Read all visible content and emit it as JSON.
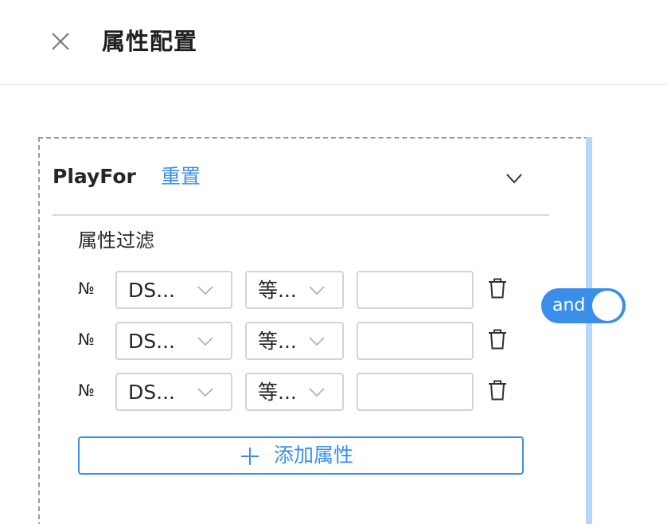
{
  "header": {
    "title": "属性配置",
    "close_icon": "close-icon"
  },
  "group": {
    "name": "PlayFor",
    "reset_label": "重置",
    "collapse_icon": "chevron-down-icon"
  },
  "filter": {
    "section_label": "属性过滤",
    "rows": [
      {
        "number_sign": "№",
        "field": "DS...",
        "operator": "等...",
        "value": ""
      },
      {
        "number_sign": "№",
        "field": "DS...",
        "operator": "等...",
        "value": ""
      },
      {
        "number_sign": "№",
        "field": "DS...",
        "operator": "等...",
        "value": ""
      }
    ],
    "add_label": "添加属性"
  },
  "logic_toggle": {
    "label": "and",
    "on": true
  },
  "colors": {
    "accent": "#3b8fe8",
    "toggle_bg": "#3a8ee9",
    "side_bar": "#b8d6f7",
    "border": "#d4d4d4",
    "dashed_border": "#9a9a9a"
  }
}
